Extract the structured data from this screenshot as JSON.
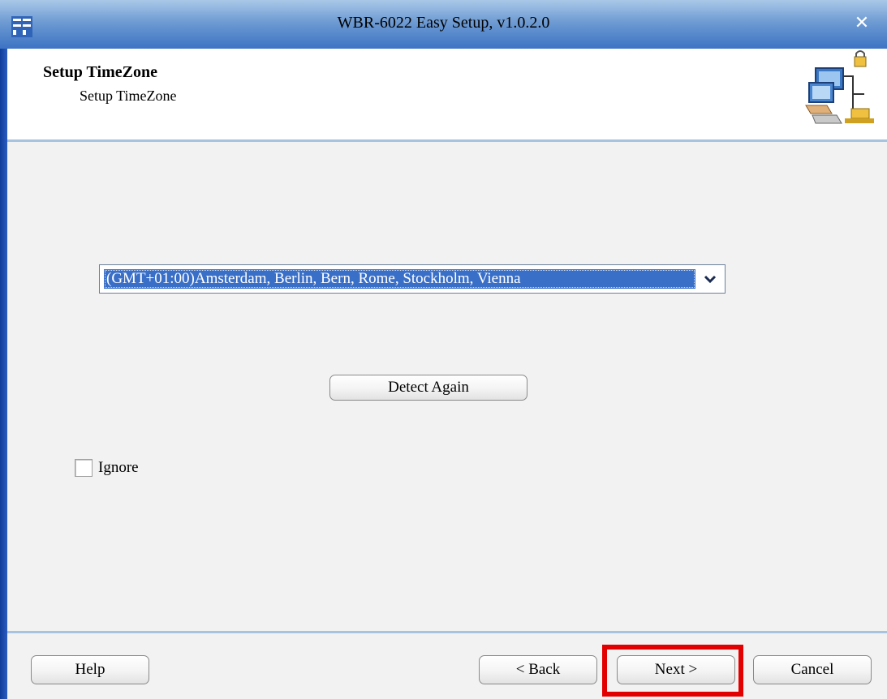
{
  "window": {
    "title": "WBR-6022 Easy Setup, v1.0.2.0",
    "close_symbol": "✕"
  },
  "header": {
    "title": "Setup TimeZone",
    "subtitle": "Setup TimeZone",
    "icon": "network-computers-icon"
  },
  "timezone": {
    "selected": "(GMT+01:00)Amsterdam, Berlin, Bern, Rome, Stockholm, Vienna",
    "dropdown_icon": "chevron-down-icon"
  },
  "detect_button": {
    "label": "Detect Again"
  },
  "ignore_checkbox": {
    "label": "Ignore",
    "checked": false
  },
  "footer": {
    "help_label": "Help",
    "back_label": "< Back",
    "next_label": "Next >",
    "cancel_label": "Cancel"
  },
  "colors": {
    "title_bar": "#3c73c4",
    "selection": "#3a6fc8",
    "highlight": "#e30000",
    "separator": "#a7c3df"
  }
}
